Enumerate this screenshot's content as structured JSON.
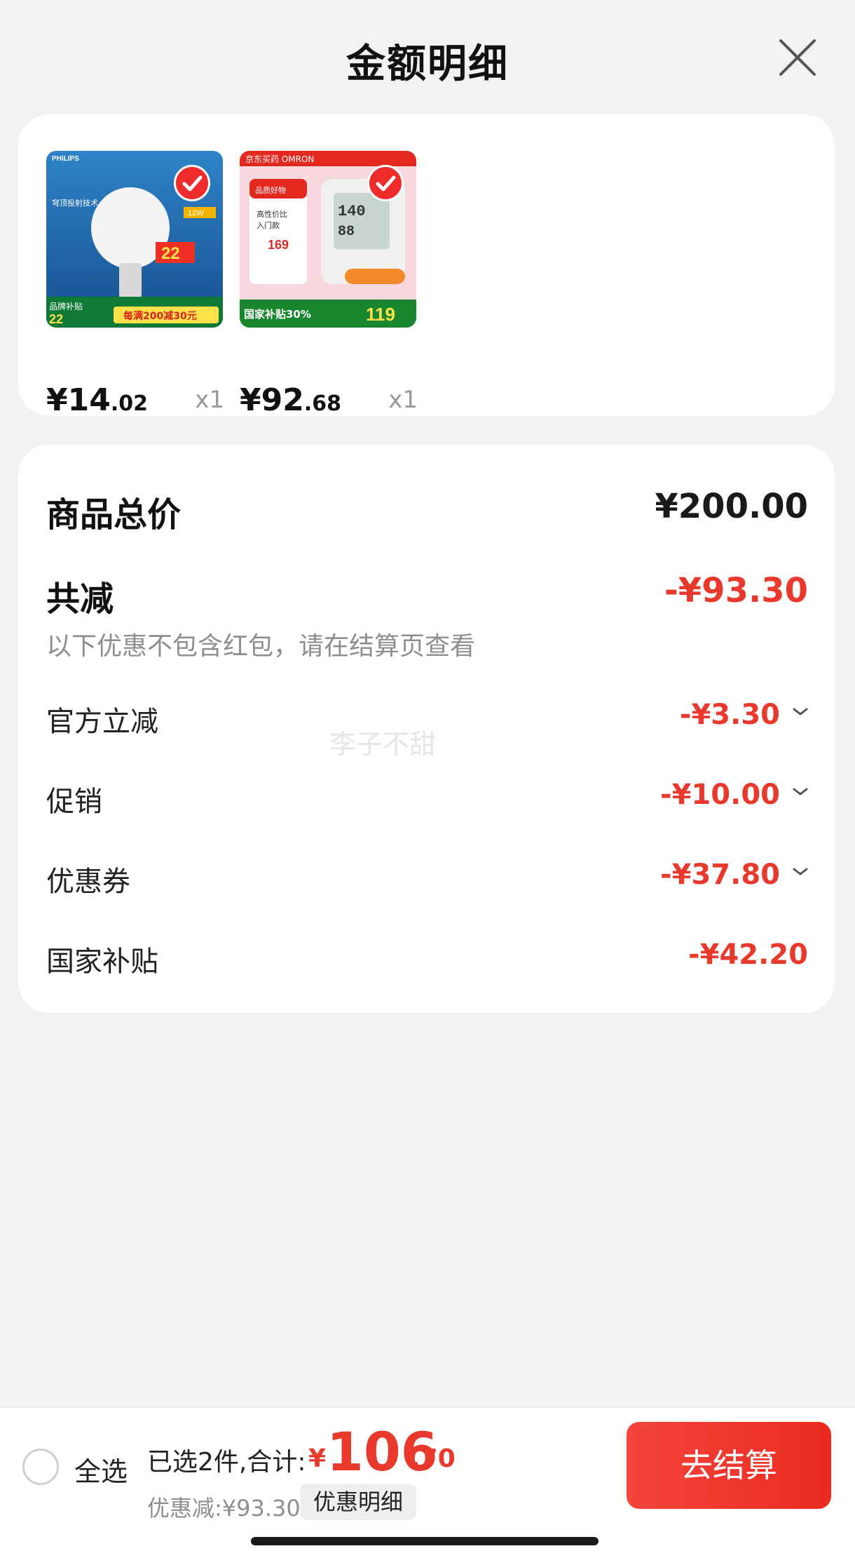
{
  "header": {
    "title": "金额明细"
  },
  "products": [
    {
      "image_brand": "PHILIPS",
      "image_badge": "22",
      "image_promo": "每满200减30元",
      "price_int": "¥14",
      "price_dec": ".02",
      "qty": "x1"
    },
    {
      "image_brand": "京东买药 OMRON",
      "image_badge": "119",
      "image_promo": "国家补贴30%",
      "price_int": "¥92",
      "price_dec": ".68",
      "qty": "x1"
    }
  ],
  "summary": {
    "total_label": "商品总价",
    "total_value": "¥200.00",
    "reduce_label": "共减",
    "reduce_value": "-¥93.30",
    "note": "以下优惠不包含红包，请在结算页查看",
    "items": [
      {
        "label": "官方立减",
        "value": "-¥3.30"
      },
      {
        "label": "促销",
        "value": "-¥10.00"
      },
      {
        "label": "优惠券",
        "value": "-¥37.80"
      },
      {
        "label": "国家补贴",
        "value": "-¥42.20"
      }
    ]
  },
  "watermark": "李子不甜",
  "bottom": {
    "select_all": "全选",
    "selected_text": "已选2件,合计:",
    "total_symbol": "¥",
    "total_int": "106",
    "total_dec": ".70",
    "discount_text": "优惠减:¥93.30",
    "detail_button": "优惠明细",
    "checkout_button": "去结算"
  },
  "colors": {
    "accent": "#e8392c",
    "background": "#f2f2f2"
  }
}
